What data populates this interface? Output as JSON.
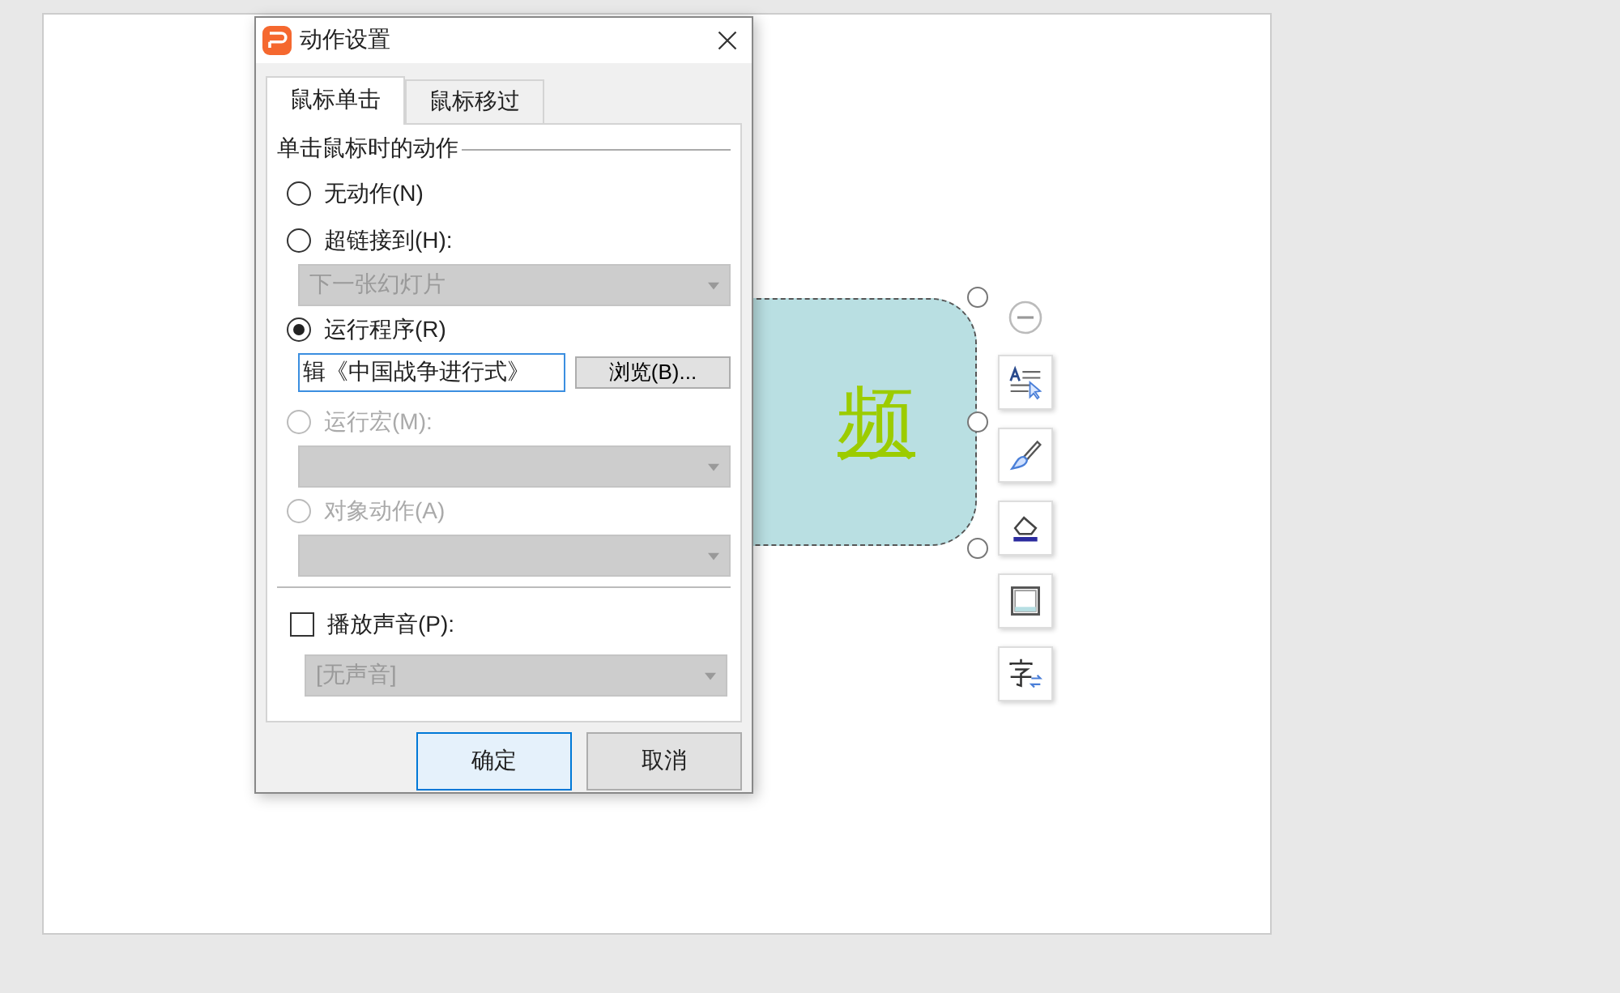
{
  "slide": {
    "shape_text": "频"
  },
  "dialog": {
    "title": "动作设置",
    "tabs": [
      {
        "label": "鼠标单击",
        "selected": true
      },
      {
        "label": "鼠标移过",
        "selected": false
      }
    ],
    "group_title": "单击鼠标时的动作",
    "options": [
      {
        "kind": "radio",
        "label": "无动作(N)",
        "selected": false,
        "disabled": false
      },
      {
        "kind": "radio",
        "label": "超链接到(H):",
        "selected": false,
        "disabled": false
      },
      {
        "kind": "dropdown",
        "value": "下一张幻灯片",
        "disabled": true
      },
      {
        "kind": "radio",
        "label": "运行程序(R)",
        "selected": true,
        "disabled": false
      },
      {
        "kind": "file",
        "value": "辑《中国战争进行式》",
        "button": "浏览(B)..."
      },
      {
        "kind": "radio",
        "label": "运行宏(M):",
        "selected": false,
        "disabled": true
      },
      {
        "kind": "dropdown",
        "disabled": true
      },
      {
        "kind": "radio",
        "label": "对象动作(A)",
        "selected": false,
        "disabled": true
      },
      {
        "kind": "dropdown",
        "disabled": true
      }
    ],
    "sound": {
      "label": "播放声音(P):",
      "checked": false,
      "value": "[无声音]",
      "disabled": true
    },
    "buttons": [
      {
        "label": "确定",
        "default": true
      },
      {
        "label": "取消",
        "default": false
      }
    ]
  }
}
